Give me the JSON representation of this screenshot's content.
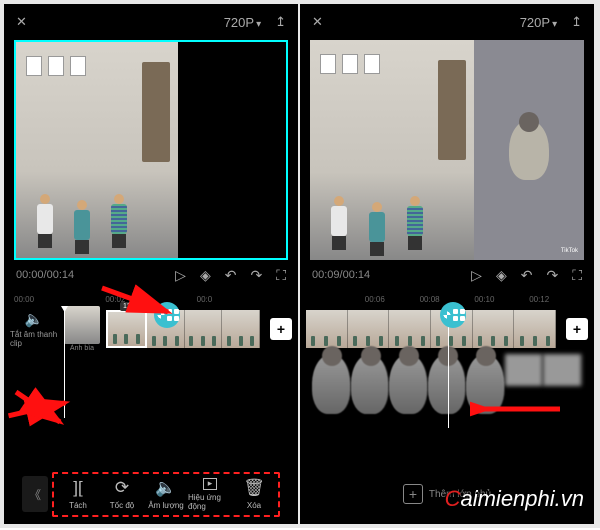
{
  "topbar": {
    "close": "✕",
    "resolution": "720P",
    "export": "↥"
  },
  "left": {
    "time_current": "00:00",
    "time_total": "00:14",
    "mute_label": "Tắt âm thanh clip",
    "cover_label": "Ảnh bìa",
    "clip_duration": "12.2s",
    "ruler": [
      "00:00",
      "00:02",
      "00:0"
    ]
  },
  "right": {
    "time_current": "00:09",
    "time_total": "00:14",
    "overlay_label": "Thêm lớp phủ",
    "ruler": [
      "",
      "00:06",
      "00:08",
      "00:10",
      "00:12"
    ]
  },
  "controls": {
    "play": "▷",
    "keyframe": "◈",
    "undo": "↶",
    "redo": "↷",
    "fullscreen": "⛶"
  },
  "tools": [
    {
      "icon": "][",
      "label": "Tách"
    },
    {
      "icon": "⟳",
      "label": "Tốc độ"
    },
    {
      "icon": "🔈",
      "label": "Âm lượng"
    },
    {
      "icon": "▸",
      "label": "Hiệu ứng động"
    },
    {
      "icon": "🗑",
      "label": "Xóa"
    }
  ],
  "watermark": "aimienphi.vn"
}
